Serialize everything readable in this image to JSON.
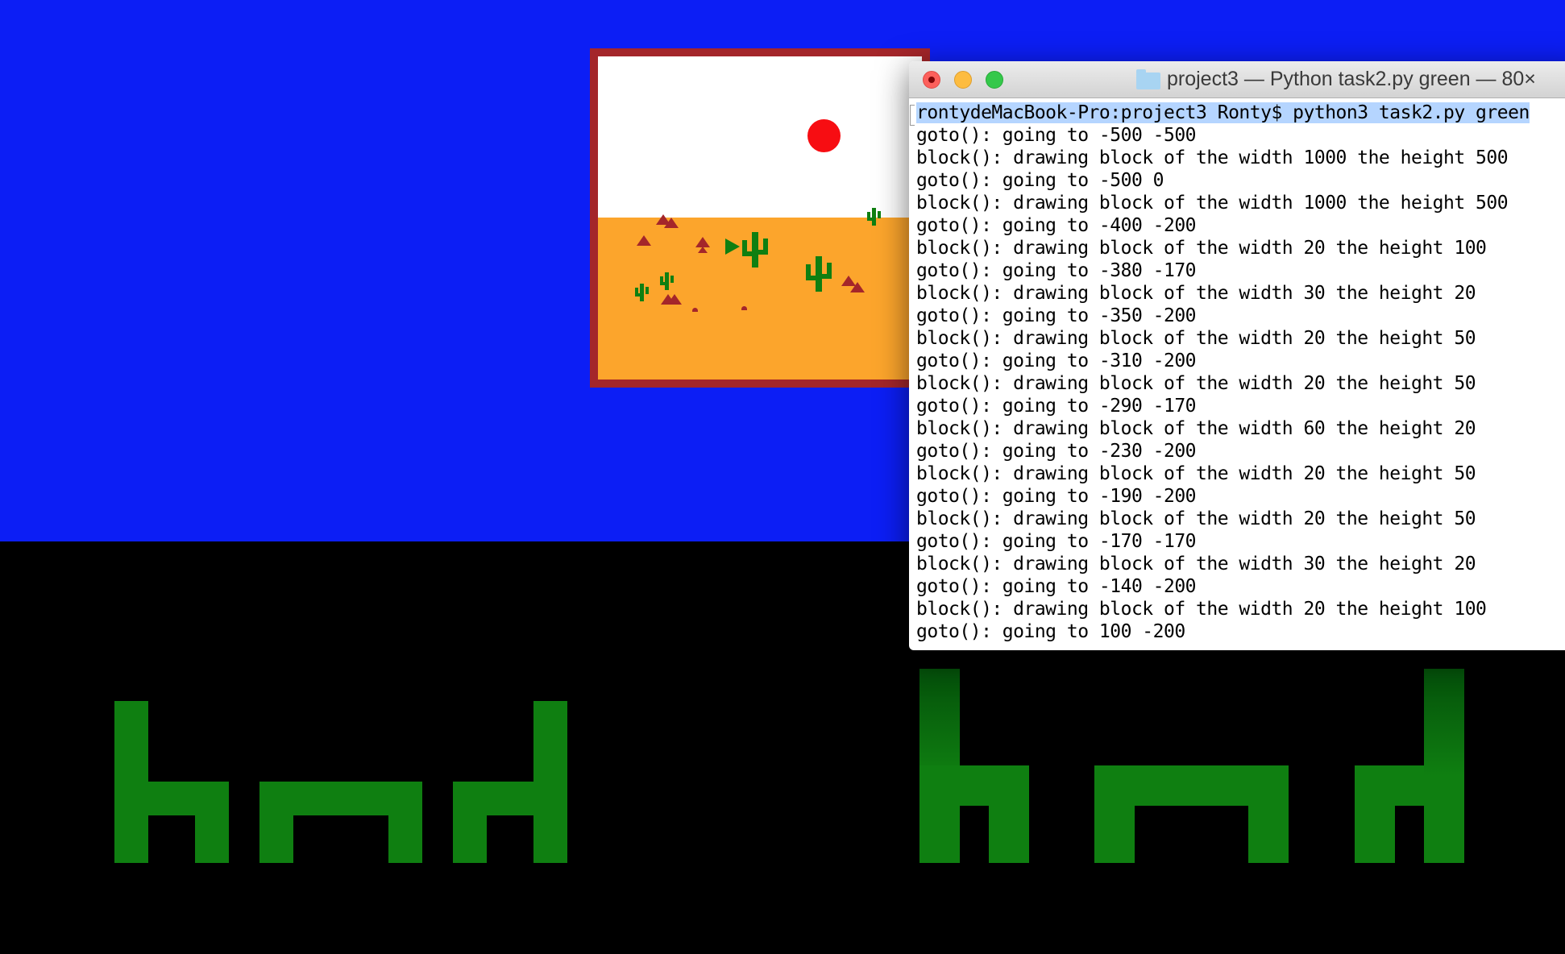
{
  "colors": {
    "desktop_sky": "#0c1ef5",
    "desktop_ground": "#000000",
    "block_green": "#0f7f11",
    "thumb_frame": "#a4262a",
    "thumb_sand": "#fca52c",
    "sun_red": "#f70d12",
    "selection": "#b5d5ff"
  },
  "terminal": {
    "title": "project3 — Python task2.py green — 80×",
    "folder_icon": "folder-icon",
    "command": "rontydeMacBook-Pro:project3 Ronty$ python3 task2.py green",
    "output_lines": [
      "goto(): going to -500 -500",
      "block(): drawing block of the width 1000 the height 500",
      "goto(): going to -500 0",
      "block(): drawing block of the width 1000 the height 500",
      "goto(): going to -400 -200",
      "block(): drawing block of the width 20 the height 100",
      "goto(): going to -380 -170",
      "block(): drawing block of the width 30 the height 20",
      "goto(): going to -350 -200",
      "block(): drawing block of the width 20 the height 50",
      "goto(): going to -310 -200",
      "block(): drawing block of the width 20 the height 50",
      "goto(): going to -290 -170",
      "block(): drawing block of the width 60 the height 20",
      "goto(): going to -230 -200",
      "block(): drawing block of the width 20 the height 50",
      "goto(): going to -190 -200",
      "block(): drawing block of the width 20 the height 50",
      "goto(): going to -170 -170",
      "block(): drawing block of the width 30 the height 20",
      "goto(): going to -140 -200",
      "block(): drawing block of the width 20 the height 100",
      "goto(): going to 100 -200"
    ]
  },
  "thumbnail": {
    "label": "turtle-preview"
  }
}
